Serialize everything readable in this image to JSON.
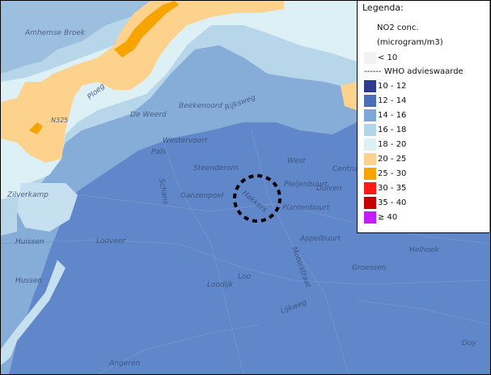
{
  "map": {
    "places": [
      {
        "name": "Amhemse Broek"
      },
      {
        "name": "De Weerd"
      },
      {
        "name": "Beekenoord"
      },
      {
        "name": "Rijksweg"
      },
      {
        "name": "Westervoort"
      },
      {
        "name": "Pals"
      },
      {
        "name": "Steenderom"
      },
      {
        "name": "Schans"
      },
      {
        "name": "Ganzenpoel"
      },
      {
        "name": "Zilverkamp"
      },
      {
        "name": "Looveer"
      },
      {
        "name": "Loo"
      },
      {
        "name": "Hussen"
      },
      {
        "name": "Loodijk"
      },
      {
        "name": "West"
      },
      {
        "name": "Centrum"
      },
      {
        "name": "Pleijenbuurt"
      },
      {
        "name": "Duiven"
      },
      {
        "name": "Plantenbuurt"
      },
      {
        "name": "Appelbuurt"
      },
      {
        "name": "Motorstraat"
      },
      {
        "name": "Helhoek"
      },
      {
        "name": "Groessen"
      },
      {
        "name": "Lijkweg"
      },
      {
        "name": "Doy"
      },
      {
        "name": "Angeren"
      },
      {
        "name": "Ploeg"
      },
      {
        "name": "N325"
      },
      {
        "name": "Huissen"
      },
      {
        "name": "Hakkers"
      }
    ],
    "marker": {
      "label": "location-marker"
    }
  },
  "legend": {
    "title": "Legenda:",
    "unit_line1": "NO2 conc.",
    "unit_line2": "(microgram/m3)",
    "who_label": "------ WHO advieswaarde",
    "classes": [
      {
        "label": "< 10",
        "color": "#f2f2f2"
      },
      {
        "label": "10 - 12",
        "color": "#2f3b8f"
      },
      {
        "label": "12 - 14",
        "color": "#4a6fb8"
      },
      {
        "label": "14 - 16",
        "color": "#7ea7d6"
      },
      {
        "label": "16 - 18",
        "color": "#b3d5ea"
      },
      {
        "label": "18 - 20",
        "color": "#dcf0f6"
      },
      {
        "label": "20 - 25",
        "color": "#fdd28c"
      },
      {
        "label": "25 - 30",
        "color": "#f8a400"
      },
      {
        "label": "30 - 35",
        "color": "#ff1a1a"
      },
      {
        "label": "35 - 40",
        "color": "#c40000"
      },
      {
        "label": "≥ 40",
        "color": "#c51bff"
      }
    ]
  }
}
